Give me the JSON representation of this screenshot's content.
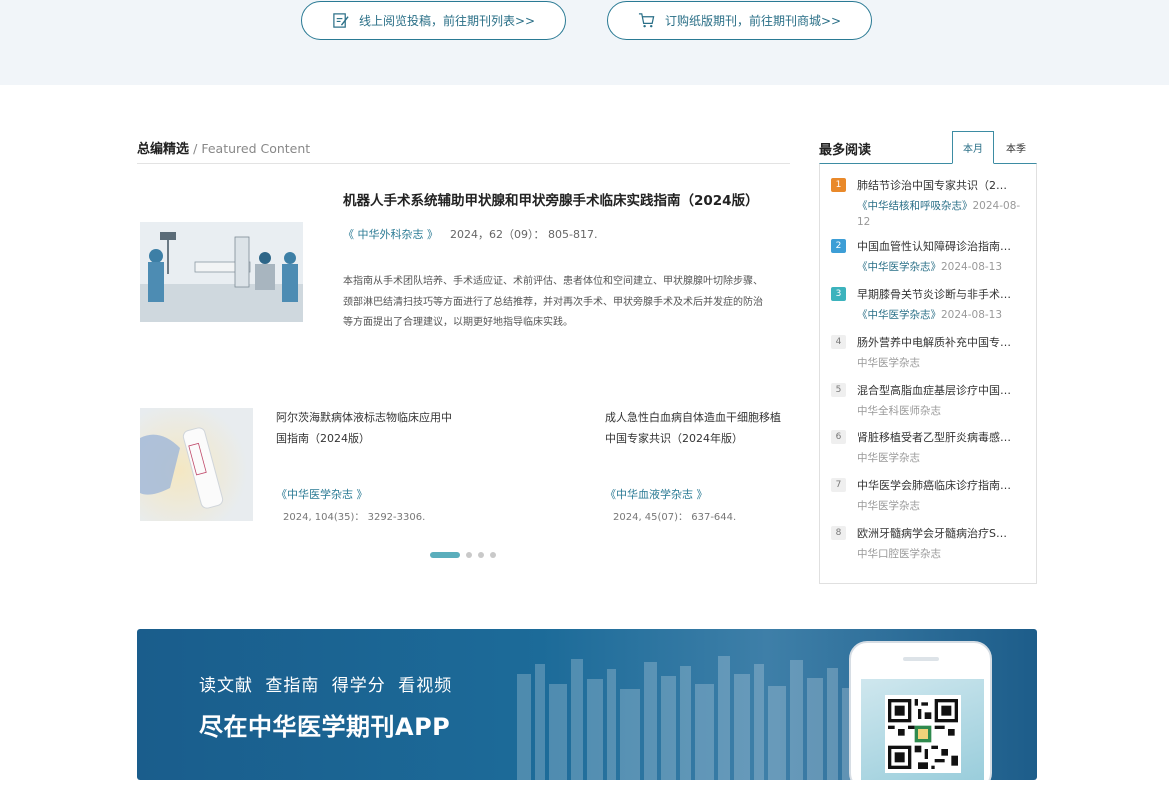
{
  "top_links": {
    "online_read": "线上阅览投稿，前往期刊列表>>",
    "buy_print": "订购纸版期刊，前往期刊商城>>"
  },
  "featured": {
    "heading_zh": "总编精选",
    "heading_en": "/ Featured Content",
    "main": {
      "title": "机器人手术系统辅助甲状腺和甲状旁腺手术临床实践指南（2024版）",
      "journal": "《 中华外科杂志 》",
      "citation": "2024，62（09）： 805-817.",
      "abstract": "本指南从手术团队培养、手术适应证、术前评估、患者体位和空间建立、甲状腺腺叶切除步骤、颈部淋巴结清扫技巧等方面进行了总结推荐，并对再次手术、甲状旁腺手术及术后并发症的防治等方面提出了合理建议，以期更好地指导临床实践。"
    },
    "cards": [
      {
        "title": "阿尔茨海默病体液标志物临床应用中国指南（2024版）",
        "journal": "《中华医学杂志 》",
        "citation": "2024, 104(35)： 3292-3306."
      },
      {
        "title": "成人急性白血病自体造血干细胞移植中国专家共识（2024年版）",
        "journal": "《中华血液学杂志 》",
        "citation": "2024, 45(07)： 637-644."
      }
    ],
    "slide_count": 4,
    "active_slide": 1
  },
  "most_read": {
    "title": "最多阅读",
    "tabs": [
      "本月",
      "本季"
    ],
    "active_tab": "本月",
    "items": [
      {
        "rank": "1",
        "title": "肺结节诊治中国专家共识（2…",
        "journal": "《中华结核和呼吸杂志》",
        "date": "2024-08-12"
      },
      {
        "rank": "2",
        "title": "中国血管性认知障碍诊治指南…",
        "journal": "《中华医学杂志》",
        "date": "2024-08-13"
      },
      {
        "rank": "3",
        "title": "早期膝骨关节炎诊断与非手术…",
        "journal": "《中华医学杂志》",
        "date": "2024-08-13"
      },
      {
        "rank": "4",
        "title": "肠外营养中电解质补充中国专…",
        "journal": "中华医学杂志",
        "date": ""
      },
      {
        "rank": "5",
        "title": "混合型高脂血症基层诊疗中国…",
        "journal": "中华全科医师杂志",
        "date": ""
      },
      {
        "rank": "6",
        "title": "肾脏移植受者乙型肝炎病毒感…",
        "journal": "中华医学杂志",
        "date": ""
      },
      {
        "rank": "7",
        "title": "中华医学会肺癌临床诊疗指南…",
        "journal": "中华医学杂志",
        "date": ""
      },
      {
        "rank": "8",
        "title": "欧洲牙髓病学会牙髓病治疗S…",
        "journal": "中华口腔医学杂志",
        "date": ""
      }
    ]
  },
  "banner": {
    "line1": "读文献 查指南 得学分 看视频",
    "line2": "尽在中华医学期刊APP"
  },
  "colors": {
    "accent": "#2a7a94",
    "rank1": "#e9892a",
    "rank2": "#3d9ed6",
    "rank3": "#3cb3bd",
    "banner": "#1c6b99"
  },
  "icons": {
    "online_read": "edit-document-icon",
    "buy_print": "shopping-cart-icon"
  }
}
